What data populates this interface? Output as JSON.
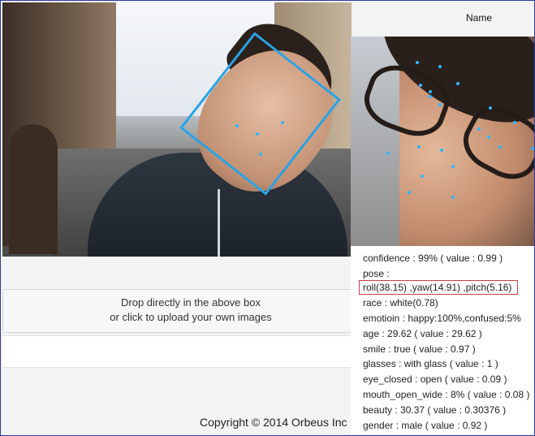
{
  "header": {
    "name_label": "Name"
  },
  "upload": {
    "line1": "Drop directly in the above box",
    "line2": "or click to upload your own images"
  },
  "footer": {
    "copyright": "Copyright © 2014 Orbeus Inc"
  },
  "result": {
    "confidence": "confidence : 99% ( value : 0.99 )",
    "pose_label": "pose :",
    "pose_value": "roll(38.15) ,yaw(14.91) ,pitch(5.16)",
    "race": "race : white(0.78)",
    "emotion": "emotioin : happy:100%,confused:5%",
    "age": "age : 29.62 ( value : 29.62 )",
    "smile": "smile : true ( value : 0.97 )",
    "glasses": "glasses : with glass ( value : 1 )",
    "eye_closed": "eye_closed : open ( value : 0.09 )",
    "mouth_open_wide": "mouth_open_wide : 8% ( value : 0.08 )",
    "beauty": "beauty : 30.37 ( value : 0.30376 )",
    "gender": "gender : male ( value : 0.92 )"
  },
  "colors": {
    "face_box": "#29a3e6",
    "landmark_dot": "#33b5ff",
    "pose_highlight": "#c94040",
    "window_border": "#2b3aa6"
  }
}
